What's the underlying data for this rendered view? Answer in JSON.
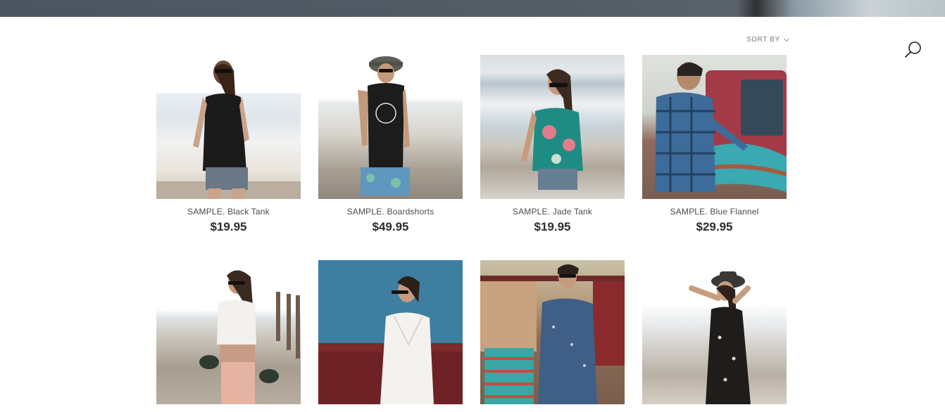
{
  "header": {
    "sort_label": "SORT BY",
    "sort_icon": "chevron-down-icon",
    "search_icon": "search-icon"
  },
  "products": [
    {
      "name": "SAMPLE. Black Tank",
      "price": "$19.95"
    },
    {
      "name": "SAMPLE. Boardshorts",
      "price": "$49.95"
    },
    {
      "name": "SAMPLE. Jade Tank",
      "price": "$19.95"
    },
    {
      "name": "SAMPLE. Blue Flannel",
      "price": "$29.95"
    },
    {
      "name": "",
      "price": ""
    },
    {
      "name": "",
      "price": ""
    },
    {
      "name": "",
      "price": ""
    },
    {
      "name": "",
      "price": ""
    }
  ],
  "colors": {
    "text_primary": "#2d2d2d",
    "text_secondary": "#4a4a4a",
    "muted": "#7a7a7a"
  }
}
